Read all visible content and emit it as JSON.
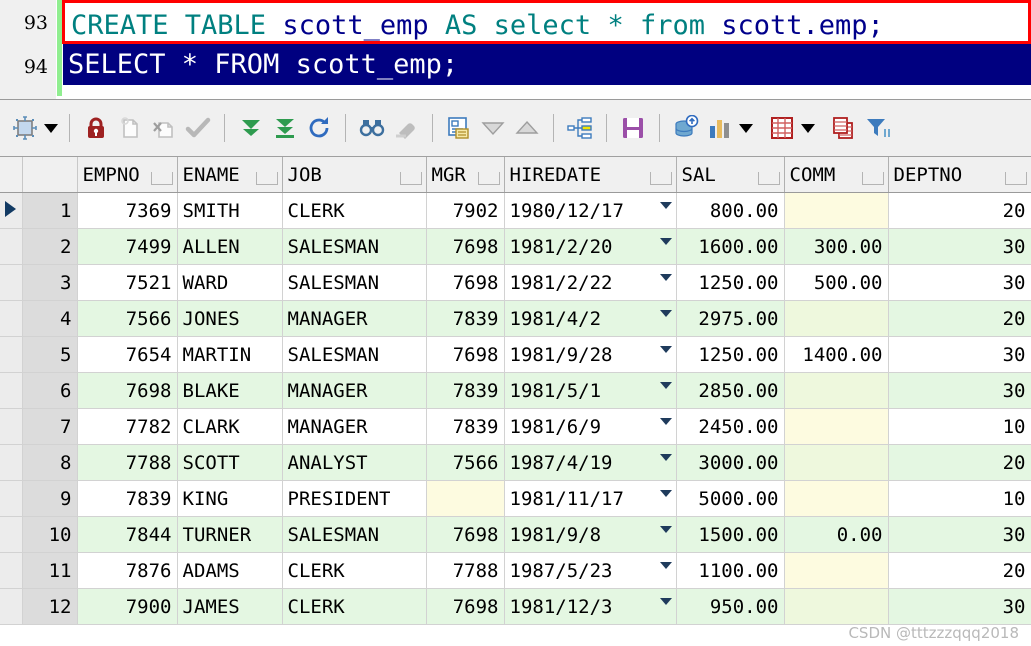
{
  "editor": {
    "lines": [
      {
        "number": "93",
        "tokens": [
          {
            "t": "CREATE TABLE ",
            "k": "kw"
          },
          {
            "t": "scott_emp ",
            "k": "id"
          },
          {
            "t": "AS select * from ",
            "k": "kw"
          },
          {
            "t": "scott.emp;",
            "k": "id"
          }
        ],
        "plain": "CREATE TABLE scott_emp AS select * from scott.emp;",
        "highlighted": true,
        "selected": false
      },
      {
        "number": "94",
        "plain": "SELECT * FROM scott_emp;",
        "highlighted": false,
        "selected": true
      }
    ]
  },
  "toolbar": {
    "buttons": [
      {
        "name": "fit-grid-icon",
        "label": "Fit grid columns"
      },
      {
        "name": "chevron-down-icon",
        "label": "Fit options"
      },
      {
        "name": "lock-icon",
        "label": "Lock record"
      },
      {
        "name": "new-record-icon",
        "label": "Insert record"
      },
      {
        "name": "delete-record-icon",
        "label": "Delete record"
      },
      {
        "name": "check-icon",
        "label": "Post changes"
      },
      {
        "name": "fetch-next-page-icon",
        "label": "Fetch next page"
      },
      {
        "name": "fetch-last-page-icon",
        "label": "Fetch last page"
      },
      {
        "name": "refresh-icon",
        "label": "Refresh"
      },
      {
        "name": "find-icon",
        "label": "Find"
      },
      {
        "name": "eraser-icon",
        "label": "Clear find"
      },
      {
        "name": "single-record-view-icon",
        "label": "Single record view"
      },
      {
        "name": "sort-descending-icon",
        "label": "Sort descending"
      },
      {
        "name": "sort-ascending-icon",
        "label": "Sort ascending"
      },
      {
        "name": "hierarchy-icon",
        "label": "Group by"
      },
      {
        "name": "save-icon",
        "label": "Export results"
      },
      {
        "name": "database-upload-icon",
        "label": "Post to database"
      },
      {
        "name": "bar-chart-icon",
        "label": "Chart"
      },
      {
        "name": "chevron-down-icon-chart",
        "label": "Chart options"
      },
      {
        "name": "grid-icon",
        "label": "Grid layout"
      },
      {
        "name": "chevron-down-icon-grid",
        "label": "Grid options"
      },
      {
        "name": "copy-grid-icon",
        "label": "Copy to clipboard"
      },
      {
        "name": "filter-icon",
        "label": "Filter"
      }
    ]
  },
  "grid": {
    "columns": [
      "EMPNO",
      "ENAME",
      "JOB",
      "MGR",
      "HIREDATE",
      "SAL",
      "COMM",
      "DEPTNO"
    ],
    "selected_row": 1,
    "rows": [
      {
        "n": "1",
        "EMPNO": "7369",
        "ENAME": "SMITH",
        "JOB": "CLERK",
        "MGR": "7902",
        "HIREDATE": "1980/12/17",
        "SAL": "800.00",
        "COMM": "",
        "DEPTNO": "20"
      },
      {
        "n": "2",
        "EMPNO": "7499",
        "ENAME": "ALLEN",
        "JOB": "SALESMAN",
        "MGR": "7698",
        "HIREDATE": "1981/2/20",
        "SAL": "1600.00",
        "COMM": "300.00",
        "DEPTNO": "30"
      },
      {
        "n": "3",
        "EMPNO": "7521",
        "ENAME": "WARD",
        "JOB": "SALESMAN",
        "MGR": "7698",
        "HIREDATE": "1981/2/22",
        "SAL": "1250.00",
        "COMM": "500.00",
        "DEPTNO": "30"
      },
      {
        "n": "4",
        "EMPNO": "7566",
        "ENAME": "JONES",
        "JOB": "MANAGER",
        "MGR": "7839",
        "HIREDATE": "1981/4/2",
        "SAL": "2975.00",
        "COMM": "",
        "DEPTNO": "20"
      },
      {
        "n": "5",
        "EMPNO": "7654",
        "ENAME": "MARTIN",
        "JOB": "SALESMAN",
        "MGR": "7698",
        "HIREDATE": "1981/9/28",
        "SAL": "1250.00",
        "COMM": "1400.00",
        "DEPTNO": "30"
      },
      {
        "n": "6",
        "EMPNO": "7698",
        "ENAME": "BLAKE",
        "JOB": "MANAGER",
        "MGR": "7839",
        "HIREDATE": "1981/5/1",
        "SAL": "2850.00",
        "COMM": "",
        "DEPTNO": "30"
      },
      {
        "n": "7",
        "EMPNO": "7782",
        "ENAME": "CLARK",
        "JOB": "MANAGER",
        "MGR": "7839",
        "HIREDATE": "1981/6/9",
        "SAL": "2450.00",
        "COMM": "",
        "DEPTNO": "10"
      },
      {
        "n": "8",
        "EMPNO": "7788",
        "ENAME": "SCOTT",
        "JOB": "ANALYST",
        "MGR": "7566",
        "HIREDATE": "1987/4/19",
        "SAL": "3000.00",
        "COMM": "",
        "DEPTNO": "20"
      },
      {
        "n": "9",
        "EMPNO": "7839",
        "ENAME": "KING",
        "JOB": "PRESIDENT",
        "MGR": "",
        "HIREDATE": "1981/11/17",
        "SAL": "5000.00",
        "COMM": "",
        "DEPTNO": "10"
      },
      {
        "n": "10",
        "EMPNO": "7844",
        "ENAME": "TURNER",
        "JOB": "SALESMAN",
        "MGR": "7698",
        "HIREDATE": "1981/9/8",
        "SAL": "1500.00",
        "COMM": "0.00",
        "DEPTNO": "30"
      },
      {
        "n": "11",
        "EMPNO": "7876",
        "ENAME": "ADAMS",
        "JOB": "CLERK",
        "MGR": "7788",
        "HIREDATE": "1987/5/23",
        "SAL": "1100.00",
        "COMM": "",
        "DEPTNO": "20"
      },
      {
        "n": "12",
        "EMPNO": "7900",
        "ENAME": "JAMES",
        "JOB": "CLERK",
        "MGR": "7698",
        "HIREDATE": "1981/12/3",
        "SAL": "950.00",
        "COMM": "",
        "DEPTNO": "30"
      }
    ]
  },
  "watermark": "CSDN @tttzzzqqq2018",
  "colors": {
    "keyword": "#008080",
    "identifier": "#00008b",
    "selection_bg": "#000080",
    "highlight_box": "#ff0000",
    "row_alt_bg": "#e4f7e2",
    "null_bg": "#fdfbe0",
    "change_bar": "#90ee90"
  }
}
